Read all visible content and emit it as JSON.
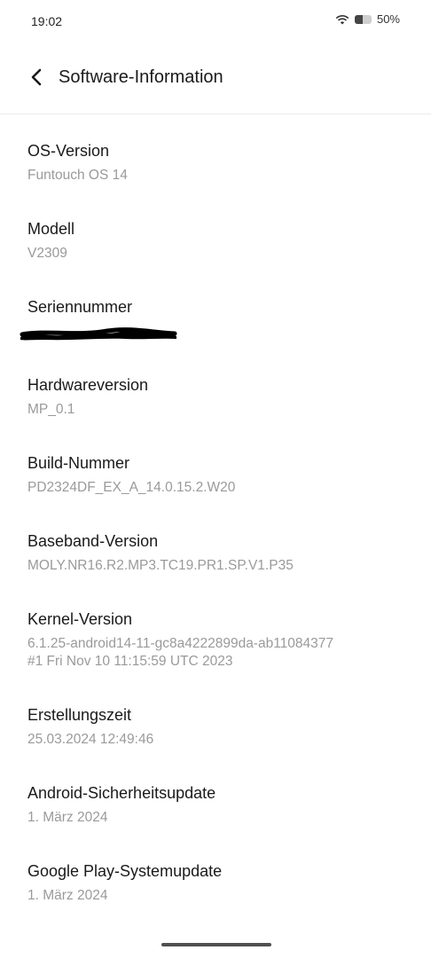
{
  "status_bar": {
    "time": "19:02",
    "battery_percent": "50%",
    "battery_level": 0.5,
    "icons": [
      "wifi-icon",
      "battery-icon"
    ]
  },
  "header": {
    "title": "Software-Information",
    "back_icon": "chevron-left-icon"
  },
  "items": [
    {
      "label": "OS-Version",
      "value": "Funtouch OS 14"
    },
    {
      "label": "Modell",
      "value": "V2309"
    },
    {
      "label": "Seriennummer",
      "value": ""
    },
    {
      "label": "Hardwareversion",
      "value": "MP_0.1"
    },
    {
      "label": "Build-Nummer",
      "value": "PD2324DF_EX_A_14.0.15.2.W20"
    },
    {
      "label": "Baseband-Version",
      "value": "MOLY.NR16.R2.MP3.TC19.PR1.SP.V1.P35"
    },
    {
      "label": "Kernel-Version",
      "value": "6.1.25-android14-11-gc8a4222899da-ab11084377\n#1 Fri Nov 10 11:15:59 UTC 2023"
    },
    {
      "label": "Erstellungszeit",
      "value": "25.03.2024 12:49:46"
    },
    {
      "label": "Android-Sicherheitsupdate",
      "value": "1. März 2024"
    },
    {
      "label": "Google Play-Systemupdate",
      "value": "1. März 2024"
    }
  ],
  "colors": {
    "label": "#1a1a1a",
    "value": "#9a9a9a",
    "background": "#ffffff"
  }
}
